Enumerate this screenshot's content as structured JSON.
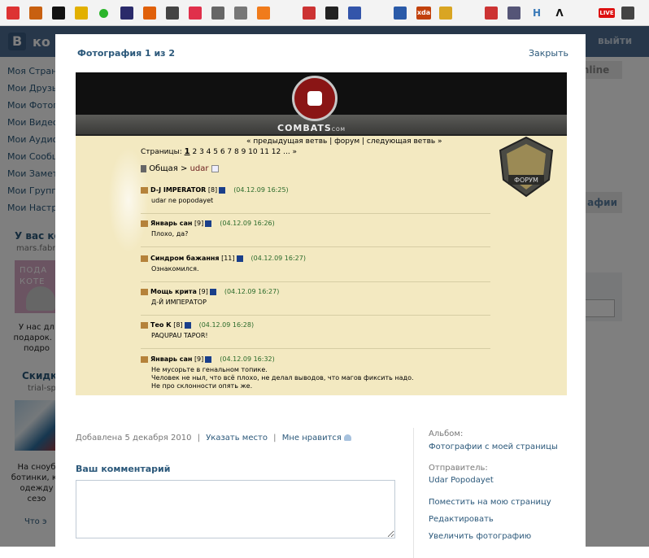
{
  "bookmarks": [
    {
      "icon": "vivaldi-red-icon",
      "color": "#d33"
    },
    {
      "icon": "orange-square-icon",
      "color": "#c86010"
    },
    {
      "icon": "heart-icon",
      "color": "#111"
    },
    {
      "icon": "star-icon",
      "color": "#e2b000"
    },
    {
      "icon": "green-dot-icon",
      "color": "#2bb52b"
    },
    {
      "icon": "person-icon",
      "color": "#2a2a6a"
    },
    {
      "icon": "letter-i-icon",
      "color": "#e0600a"
    },
    {
      "icon": "app-icon",
      "color": "#444"
    },
    {
      "icon": "pocket-icon",
      "color": "#e0304b"
    },
    {
      "icon": "film-reel-icon",
      "color": "#666"
    },
    {
      "icon": "swords-icon",
      "color": "#777"
    },
    {
      "icon": "letter-c-icon",
      "color": "#f07b1b"
    },
    {
      "icon": "k-icon",
      "color": "#c33"
    },
    {
      "icon": "gamepad-icon",
      "color": "#222"
    },
    {
      "icon": "playstation-icon",
      "color": "#3355aa"
    },
    {
      "icon": "mail-icon",
      "color": "#2a5aa8"
    },
    {
      "icon": "xda-icon",
      "color": "#c2410c",
      "label": "xda"
    },
    {
      "icon": "palette-icon",
      "color": "#d9a522"
    },
    {
      "icon": "shield-icon",
      "color": "#c33"
    },
    {
      "icon": "id-card-icon",
      "color": "#557"
    },
    {
      "icon": "letter-h-icon",
      "color": "#3a7ab8",
      "label": "H"
    },
    {
      "icon": "lambda-icon",
      "color": "#111",
      "label": "Λ"
    },
    {
      "icon": "live-icon",
      "color": "#d11",
      "label": "LIVE"
    },
    {
      "icon": "nhl-icon",
      "color": "#444"
    }
  ],
  "background": {
    "logo": "В",
    "logo_tail": "ко",
    "exit": "выйти",
    "menu": [
      "Моя Страни",
      "Мои Друзья",
      "Мои Фотогр",
      "Мои Видеоз",
      "Мои Аудиоз",
      "Мои Сообщ",
      "Мои Заметк",
      "Мои Группы",
      "Мои Настро"
    ],
    "block1_title": "У вас ко",
    "block1_domain": "mars.fabrik",
    "ad1_text": "ПОДА\nКОТЕ",
    "block1_text": "У нас дл\nподарок. Е\nподро",
    "block2_title": "Скидк",
    "block2_domain": "trial-sp",
    "block2_text": "На сноуб\nботинки, кр\nодежду\nсезо",
    "bottom_text": "Что э",
    "right_tab": "Online",
    "right_button": "афии"
  },
  "modal": {
    "title": "Фотография 1 из 2",
    "close": "Закрыть",
    "photo": {
      "logo": "COMBATS",
      "logo_suffix": "COM",
      "nav": "« предыдущая ветвь | форум | следующая ветвь »",
      "pages_label": "Страницы:",
      "pages_current": "1",
      "pages_rest": "2 3 4 5 6 7 8 9 10 11 12 ... »",
      "breadcrumb_root": "Общая",
      "breadcrumb_sep": ">",
      "breadcrumb_dir": "udar",
      "shield_label": "ФОРУМ",
      "posts": [
        {
          "nick": "D-J IMPERATOR",
          "level": "[8]",
          "time": "(04.12.09 16:25)",
          "text": "udar ne popodayet"
        },
        {
          "nick": "Январь сан",
          "level": "[9]",
          "time": "(04.12.09 16:26)",
          "text": "Плохо, да?"
        },
        {
          "nick": "Синдром бажання",
          "level": "[11]",
          "time": "(04.12.09 16:27)",
          "text": "Ознакомился."
        },
        {
          "nick": "Мощь крита",
          "level": "[9]",
          "time": "(04.12.09 16:27)",
          "text": "Д-Й ИМПЕРАТОР"
        },
        {
          "nick": "Тео К",
          "level": "[8]",
          "time": "(04.12.09 16:28)",
          "text": "PAQUPAU TAPOR!"
        },
        {
          "nick": "Январь сан",
          "level": "[9]",
          "time": "(04.12.09 16:32)",
          "text": "Не мусорьте в генальном топике.\nЧеловек не ныл, что всё плохо, не делал выводов, что магов фиксить надо.\nНе про склонности опять же."
        }
      ]
    },
    "meta": {
      "added": "Добавлена 5 декабря 2010",
      "sep1": "|",
      "place": "Указать место",
      "sep2": "|",
      "like": "Мне нравится"
    },
    "comment_title": "Ваш комментарий",
    "comment_value": "",
    "sidebar": {
      "album_label": "Альбом:",
      "album_value": "Фотографии с моей страницы",
      "sender_label": "Отправитель:",
      "sender_value": "Udar Popodayet",
      "actions": [
        "Поместить на мою страницу",
        "Редактировать",
        "Увеличить фотографию"
      ]
    }
  }
}
